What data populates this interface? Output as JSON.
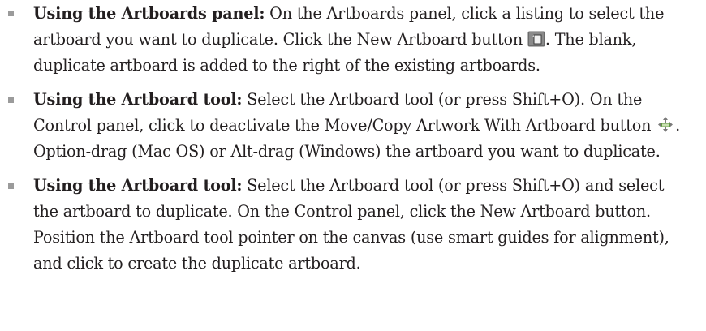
{
  "items": [
    {
      "lead": "Using the Artboards panel:",
      "text1": " On the Artboards panel, click a listing to select the artboard you want to duplicate. Click the New Artboard button ",
      "icon": "new-artboard-icon",
      "text2": ". The blank, duplicate artboard is added to the right of the existing artboards."
    },
    {
      "lead": "Using the Artboard tool:",
      "text1": " Select the Artboard tool (or press Shift+O). On the Control panel, click to deactivate the Move/Copy Artwork With Artboard button ",
      "icon": "move-copy-artwork-icon",
      "text2": ". Option-drag (Mac OS) or Alt-drag (Windows) the artboard you want to duplicate."
    },
    {
      "lead": "Using the Artboard tool:",
      "text1": " Select the Artboard tool (or press Shift+O) and select the artboard to duplicate. On the Control panel, click the New Artboard button. Position the Artboard tool pointer on the canvas (use smart guides for alignment), and click to create the duplicate artboard."
    }
  ]
}
